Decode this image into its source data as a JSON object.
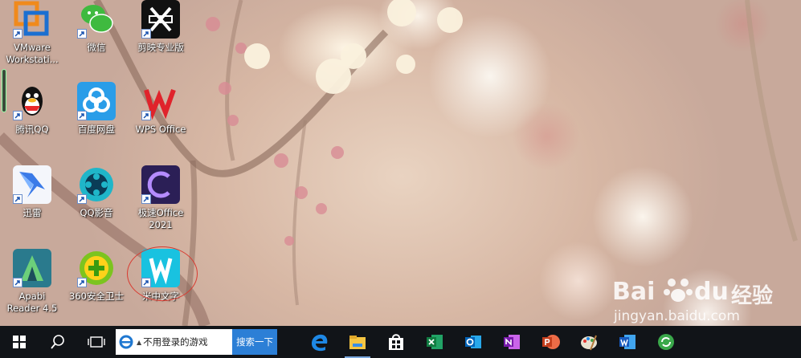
{
  "desktop": {
    "icons": [
      {
        "label": "VMware Workstati...",
        "icon": "vmware-icon"
      },
      {
        "label": "微信",
        "icon": "wechat-icon"
      },
      {
        "label": "剪映专业版",
        "icon": "jianying-icon"
      },
      {
        "label": "腾讯QQ",
        "icon": "qq-icon"
      },
      {
        "label": "百度网盘",
        "icon": "baidu-netdisk-icon"
      },
      {
        "label": "WPS Office",
        "icon": "wps-office-icon"
      },
      {
        "label": "迅雷",
        "icon": "xunlei-icon"
      },
      {
        "label": "QQ影音",
        "icon": "qq-player-icon"
      },
      {
        "label": "极速Office 2021",
        "icon": "jisu-office-icon"
      },
      {
        "label": "Apabi Reader 4.5",
        "icon": "apabi-reader-icon"
      },
      {
        "label": "360安全卫士",
        "icon": "360-safe-icon"
      },
      {
        "label": "米中文字",
        "icon": "mizhong-wenzi-icon"
      }
    ],
    "annotation_color": "#d93a30"
  },
  "watermark": {
    "brand": "Bai",
    "brand2": "du",
    "brand_cn": "经验",
    "url": "jingyan.baidu.com"
  },
  "taskbar": {
    "search_text": "不用登录的游戏",
    "search_button": "搜索一下",
    "apps": [
      "edge-icon",
      "file-explorer-icon",
      "store-icon",
      "excel-icon",
      "outlook-icon",
      "onenote-icon",
      "powerpoint-icon",
      "paint-icon",
      "word-icon",
      "sync-icon"
    ],
    "accent": "#2c7fd6"
  }
}
